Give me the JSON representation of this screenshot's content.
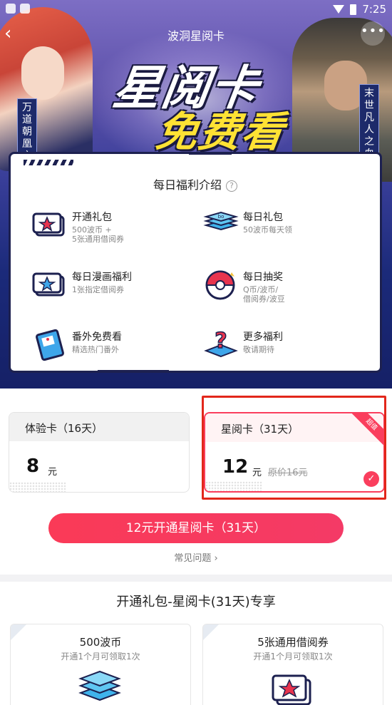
{
  "status_bar": {
    "time": "7:25"
  },
  "header": {
    "back_icon": "chevron-left",
    "title": "波洞星阅卡",
    "more_icon": "more-dots"
  },
  "banner": {
    "logo_line1": "星阅卡",
    "logo_line2": "免费看",
    "left_tag": "万道朝凰之",
    "right_tag": "末世凡人之血色"
  },
  "benefits": {
    "title": "每日福利介绍",
    "help_icon": "question-circle",
    "items": [
      {
        "icon": "ticket-star-icon",
        "name": "开通礼包",
        "desc": "500波币 +\n5张通用借阅券"
      },
      {
        "icon": "coin-stack-icon",
        "name": "每日礼包",
        "desc": "50波币每天领"
      },
      {
        "icon": "ticket-star-blue-icon",
        "name": "每日漫画福利",
        "desc": "1张指定借阅券"
      },
      {
        "icon": "lottery-ball-icon",
        "name": "每日抽奖",
        "desc": "Q币/波币/\n借阅券/波豆"
      },
      {
        "icon": "book-icon",
        "name": "番外免费看",
        "desc": "精选热门番外"
      },
      {
        "icon": "question-box-icon",
        "name": "更多福利",
        "desc": "敬请期待"
      }
    ]
  },
  "plans": [
    {
      "name": "体验卡（16天）",
      "price": "8",
      "unit": "元",
      "selected": false
    },
    {
      "name": "星阅卡（31天）",
      "price": "12",
      "unit": "元",
      "original": "原价16元",
      "badge": "超值",
      "selected": true
    }
  ],
  "cta": {
    "label": "12元开通星阅卡（31天）"
  },
  "faq": {
    "label": "常见问题",
    "chevron": "›"
  },
  "gift": {
    "title": "开通礼包-星阅卡(31天)专享",
    "cards": [
      {
        "title": "500波币",
        "sub": "开通1个月可领取1次",
        "icon": "coin-stack-icon"
      },
      {
        "title": "5张通用借阅券",
        "sub": "开通1个月可领取1次",
        "icon": "ticket-star-icon"
      }
    ]
  },
  "colors": {
    "accent": "#fa3e5d",
    "panel_border": "#1d2150",
    "highlight_box": "#e2271b"
  }
}
